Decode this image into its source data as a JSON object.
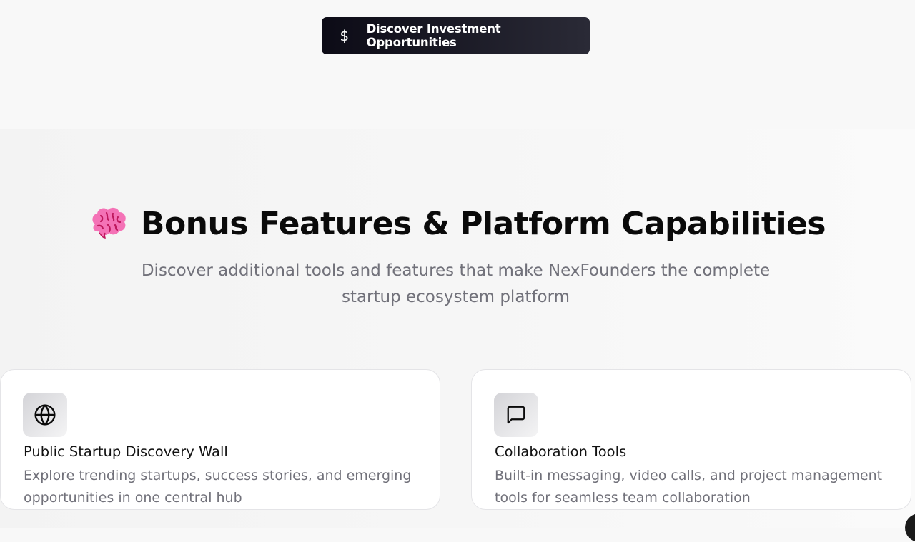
{
  "cta": {
    "icon": "dollar-icon",
    "icon_glyph": "$",
    "label": "Discover Investment Opportunities"
  },
  "section": {
    "emoji": "brain-emoji",
    "title": "Bonus Features & Platform Capabilities",
    "subtitle": "Discover additional tools and features that make NexFounders the complete startup ecosystem platform"
  },
  "cards": [
    {
      "icon": "globe-icon",
      "title": "Public Startup Discovery Wall",
      "description": "Explore trending startups, success stories, and emerging opportunities in one central hub"
    },
    {
      "icon": "message-square-icon",
      "title": "Collaboration Tools",
      "description": "Built-in messaging, video calls, and project management tools for seamless team collaboration"
    }
  ],
  "colors": {
    "cta_bg_start": "#0c0b16",
    "cta_bg_end": "#2a2a36",
    "muted_text": "#71717a",
    "emoji_pink": "#f472b6"
  }
}
